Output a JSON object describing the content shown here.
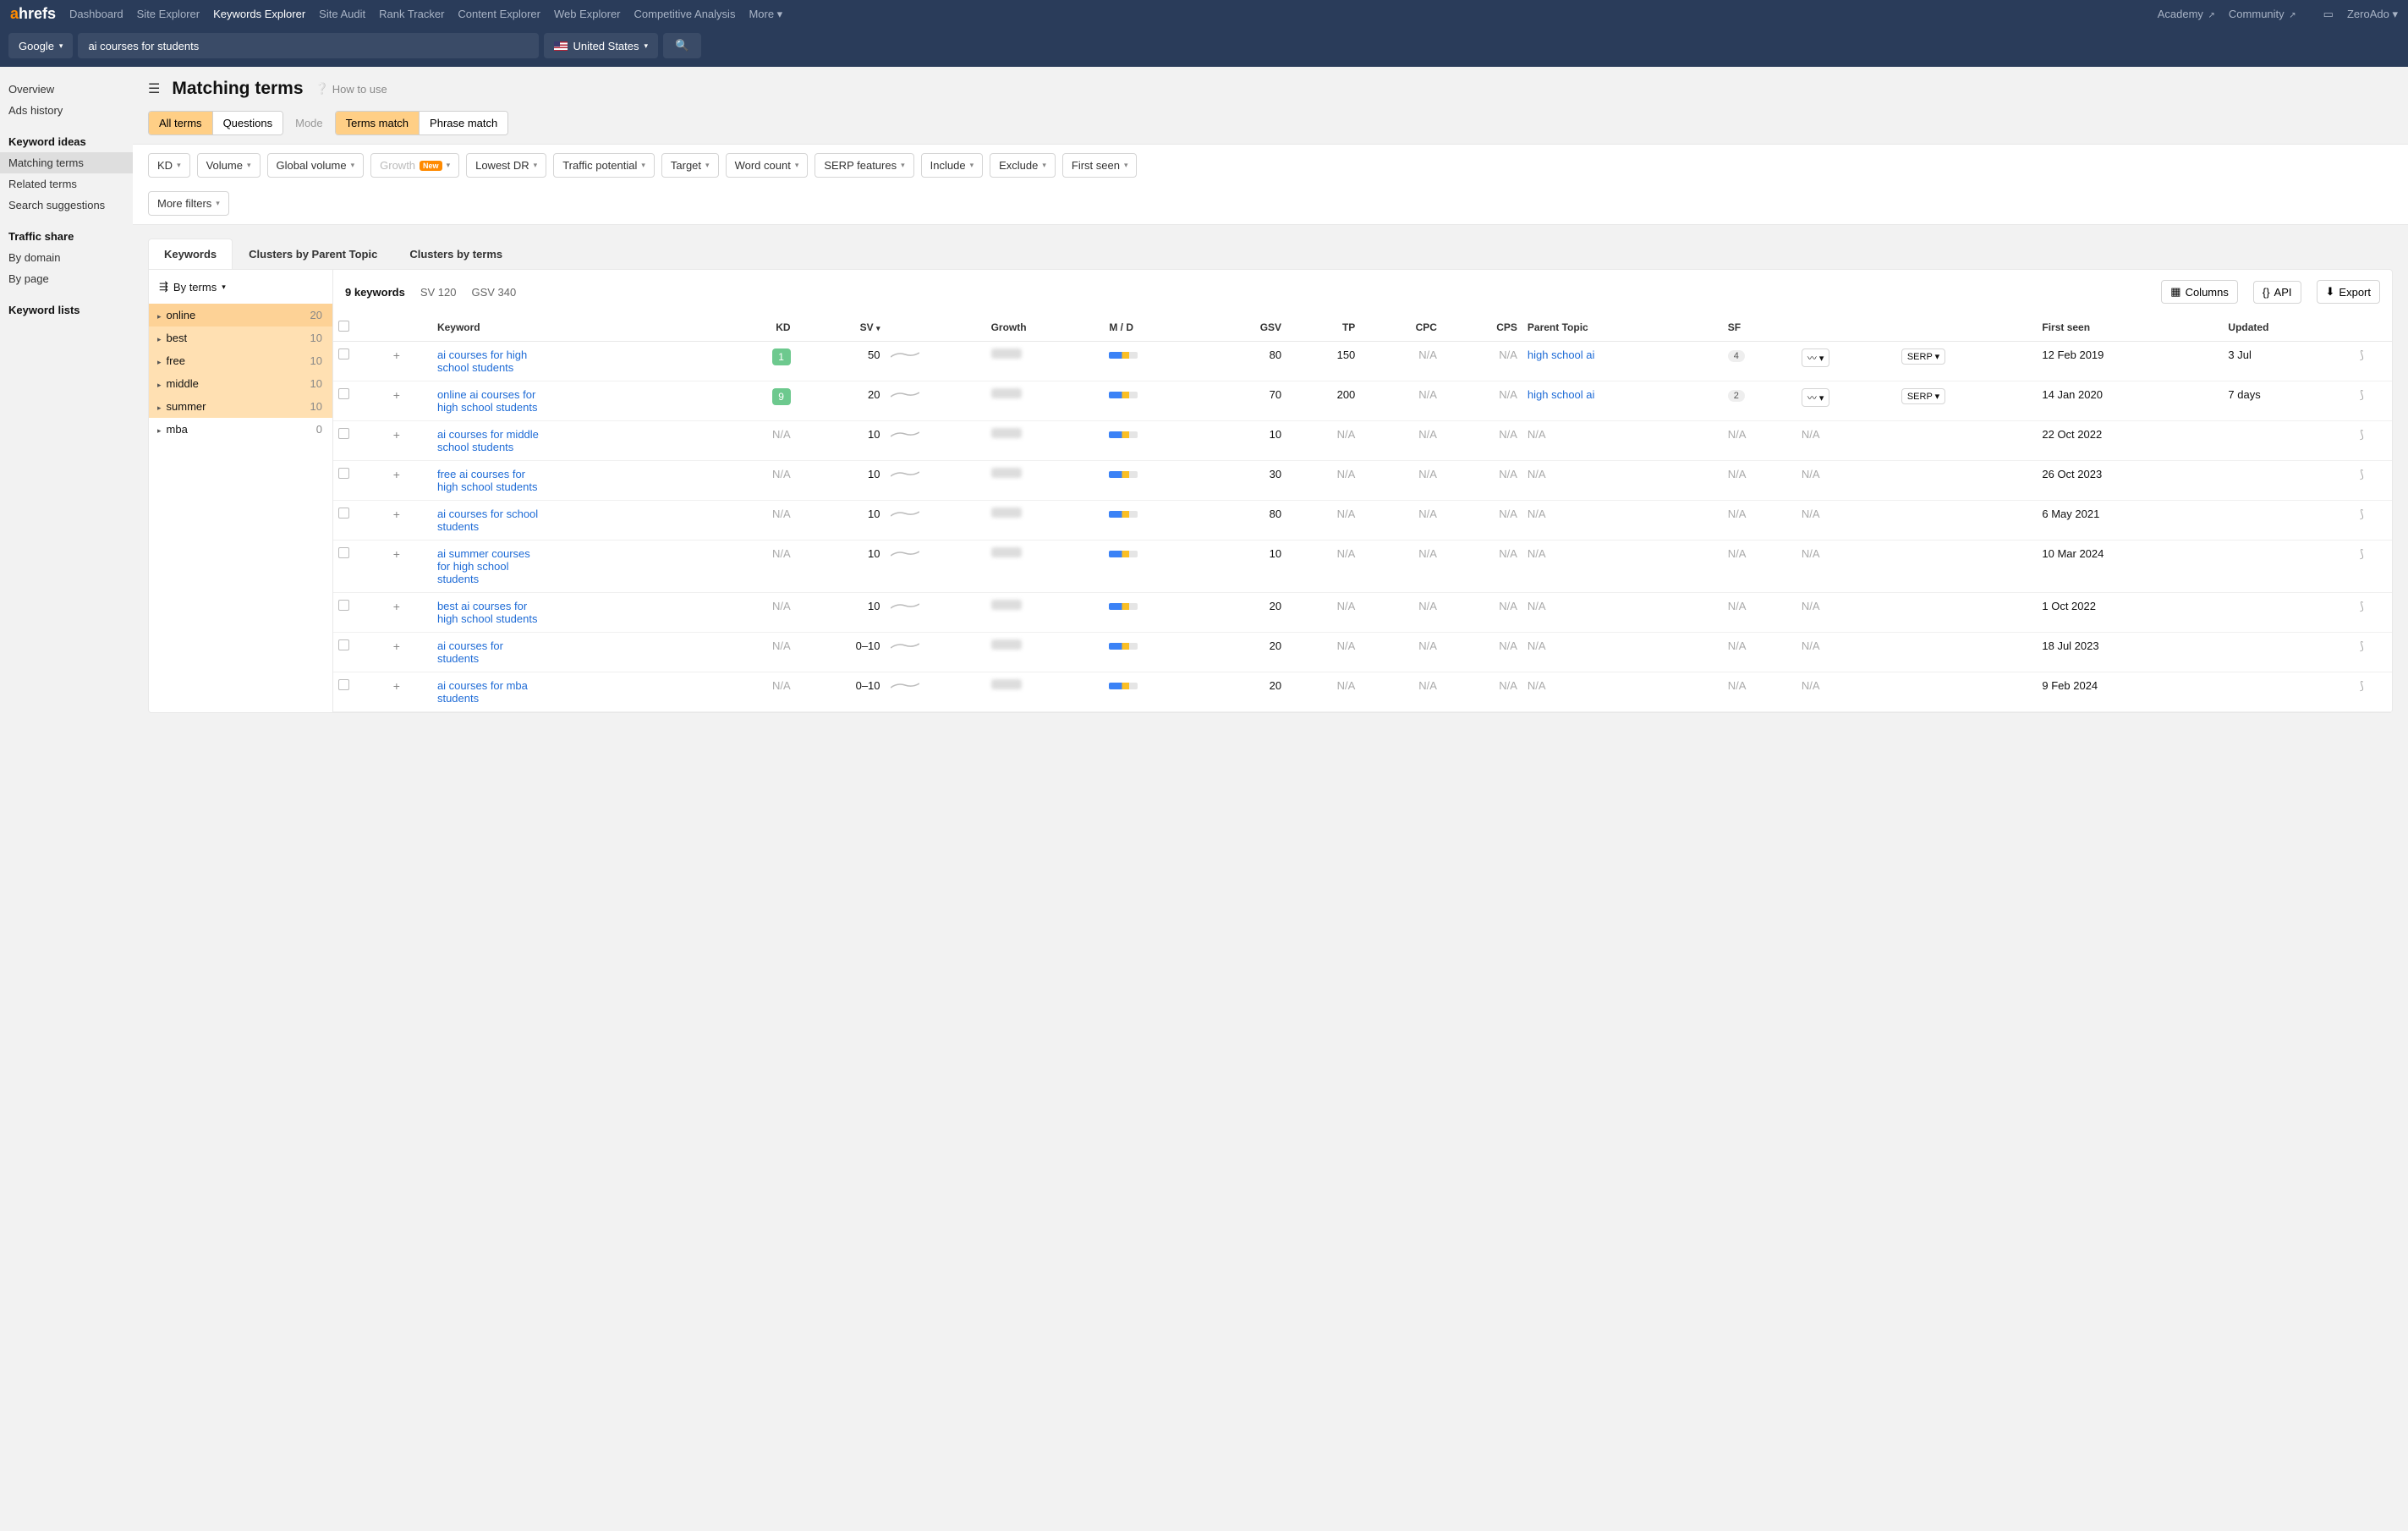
{
  "topnav": {
    "brand_a": "a",
    "brand_rest": "hrefs",
    "items": [
      "Dashboard",
      "Site Explorer",
      "Keywords Explorer",
      "Site Audit",
      "Rank Tracker",
      "Content Explorer",
      "Web Explorer",
      "Competitive Analysis",
      "More"
    ],
    "active_index": 2,
    "right_items": [
      "Academy",
      "Community"
    ],
    "user": "ZeroAdo"
  },
  "subbar": {
    "engine": "Google",
    "query": "ai courses for students",
    "country": "United States"
  },
  "sidebar": {
    "groups": [
      {
        "heading": null,
        "items": [
          "Overview",
          "Ads history"
        ]
      },
      {
        "heading": "Keyword ideas",
        "items": [
          "Matching terms",
          "Related terms",
          "Search suggestions"
        ],
        "active": "Matching terms"
      },
      {
        "heading": "Traffic share",
        "items": [
          "By domain",
          "By page"
        ]
      },
      {
        "heading": "Keyword lists",
        "items": []
      }
    ]
  },
  "page": {
    "title": "Matching terms",
    "howto": "How to use",
    "mode_label": "Mode",
    "group1": [
      "All terms",
      "Questions"
    ],
    "group1_sel": 0,
    "group2": [
      "Terms match",
      "Phrase match"
    ],
    "group2_sel": 0
  },
  "filters": [
    "KD",
    "Volume",
    "Global volume",
    "Growth",
    "Lowest DR",
    "Traffic potential",
    "Target",
    "Word count",
    "SERP features",
    "Include",
    "Exclude",
    "First seen",
    "More filters"
  ],
  "filter_new_index": 3,
  "tabs": [
    "Keywords",
    "Clusters by Parent Topic",
    "Clusters by terms"
  ],
  "tabs_active": 0,
  "leftcol": {
    "by": "By terms",
    "terms": [
      {
        "name": "online",
        "count": 20,
        "hl": 0
      },
      {
        "name": "best",
        "count": 10,
        "hl": 1
      },
      {
        "name": "free",
        "count": 10,
        "hl": 1
      },
      {
        "name": "middle",
        "count": 10,
        "hl": 1
      },
      {
        "name": "summer",
        "count": 10,
        "hl": 1
      },
      {
        "name": "mba",
        "count": 0,
        "hl": -1
      }
    ]
  },
  "results": {
    "count_label": "9 keywords",
    "sv_label": "SV 120",
    "gsv_label": "GSV 340",
    "buttons": {
      "columns": "Columns",
      "api": "API",
      "export": "Export"
    },
    "headers": [
      "",
      "",
      "Keyword",
      "KD",
      "SV",
      "",
      "Growth",
      "M / D",
      "GSV",
      "TP",
      "CPC",
      "CPS",
      "Parent Topic",
      "SF",
      "",
      "",
      "First seen",
      "Updated",
      ""
    ],
    "sv_sorted_desc": true,
    "rows": [
      {
        "kw": "ai courses for high school students",
        "kd": "1",
        "kd_pill": true,
        "sv": "50",
        "gsv": "80",
        "tp": "150",
        "cpc": "N/A",
        "cps": "N/A",
        "parent": "high school ai",
        "sf": "4",
        "serp": true,
        "first": "12 Feb 2019",
        "updated": "3 Jul"
      },
      {
        "kw": "online ai courses for high school students",
        "kd": "9",
        "kd_pill": true,
        "sv": "20",
        "gsv": "70",
        "tp": "200",
        "cpc": "N/A",
        "cps": "N/A",
        "parent": "high school ai",
        "sf": "2",
        "serp": true,
        "first": "14 Jan 2020",
        "updated": "7 days"
      },
      {
        "kw": "ai courses for middle school students",
        "kd": "N/A",
        "kd_pill": false,
        "sv": "10",
        "gsv": "10",
        "tp": "N/A",
        "cpc": "N/A",
        "cps": "N/A",
        "parent": "N/A",
        "sf": "N/A",
        "serp": false,
        "first": "22 Oct 2022",
        "updated": ""
      },
      {
        "kw": "free ai courses for high school students",
        "kd": "N/A",
        "kd_pill": false,
        "sv": "10",
        "gsv": "30",
        "tp": "N/A",
        "cpc": "N/A",
        "cps": "N/A",
        "parent": "N/A",
        "sf": "N/A",
        "serp": false,
        "first": "26 Oct 2023",
        "updated": ""
      },
      {
        "kw": "ai courses for school students",
        "kd": "N/A",
        "kd_pill": false,
        "sv": "10",
        "gsv": "80",
        "tp": "N/A",
        "cpc": "N/A",
        "cps": "N/A",
        "parent": "N/A",
        "sf": "N/A",
        "serp": false,
        "first": "6 May 2021",
        "updated": ""
      },
      {
        "kw": "ai summer courses for high school students",
        "kd": "N/A",
        "kd_pill": false,
        "sv": "10",
        "gsv": "10",
        "tp": "N/A",
        "cpc": "N/A",
        "cps": "N/A",
        "parent": "N/A",
        "sf": "N/A",
        "serp": false,
        "first": "10 Mar 2024",
        "updated": ""
      },
      {
        "kw": "best ai courses for high school students",
        "kd": "N/A",
        "kd_pill": false,
        "sv": "10",
        "gsv": "20",
        "tp": "N/A",
        "cpc": "N/A",
        "cps": "N/A",
        "parent": "N/A",
        "sf": "N/A",
        "serp": false,
        "first": "1 Oct 2022",
        "updated": ""
      },
      {
        "kw": "ai courses for students",
        "kd": "N/A",
        "kd_pill": false,
        "sv": "0–10",
        "gsv": "20",
        "tp": "N/A",
        "cpc": "N/A",
        "cps": "N/A",
        "parent": "N/A",
        "sf": "N/A",
        "serp": false,
        "first": "18 Jul 2023",
        "updated": ""
      },
      {
        "kw": "ai courses for mba students",
        "kd": "N/A",
        "kd_pill": false,
        "sv": "0–10",
        "gsv": "20",
        "tp": "N/A",
        "cpc": "N/A",
        "cps": "N/A",
        "parent": "N/A",
        "sf": "N/A",
        "serp": false,
        "first": "9 Feb 2024",
        "updated": ""
      }
    ],
    "serp_label": "SERP"
  }
}
